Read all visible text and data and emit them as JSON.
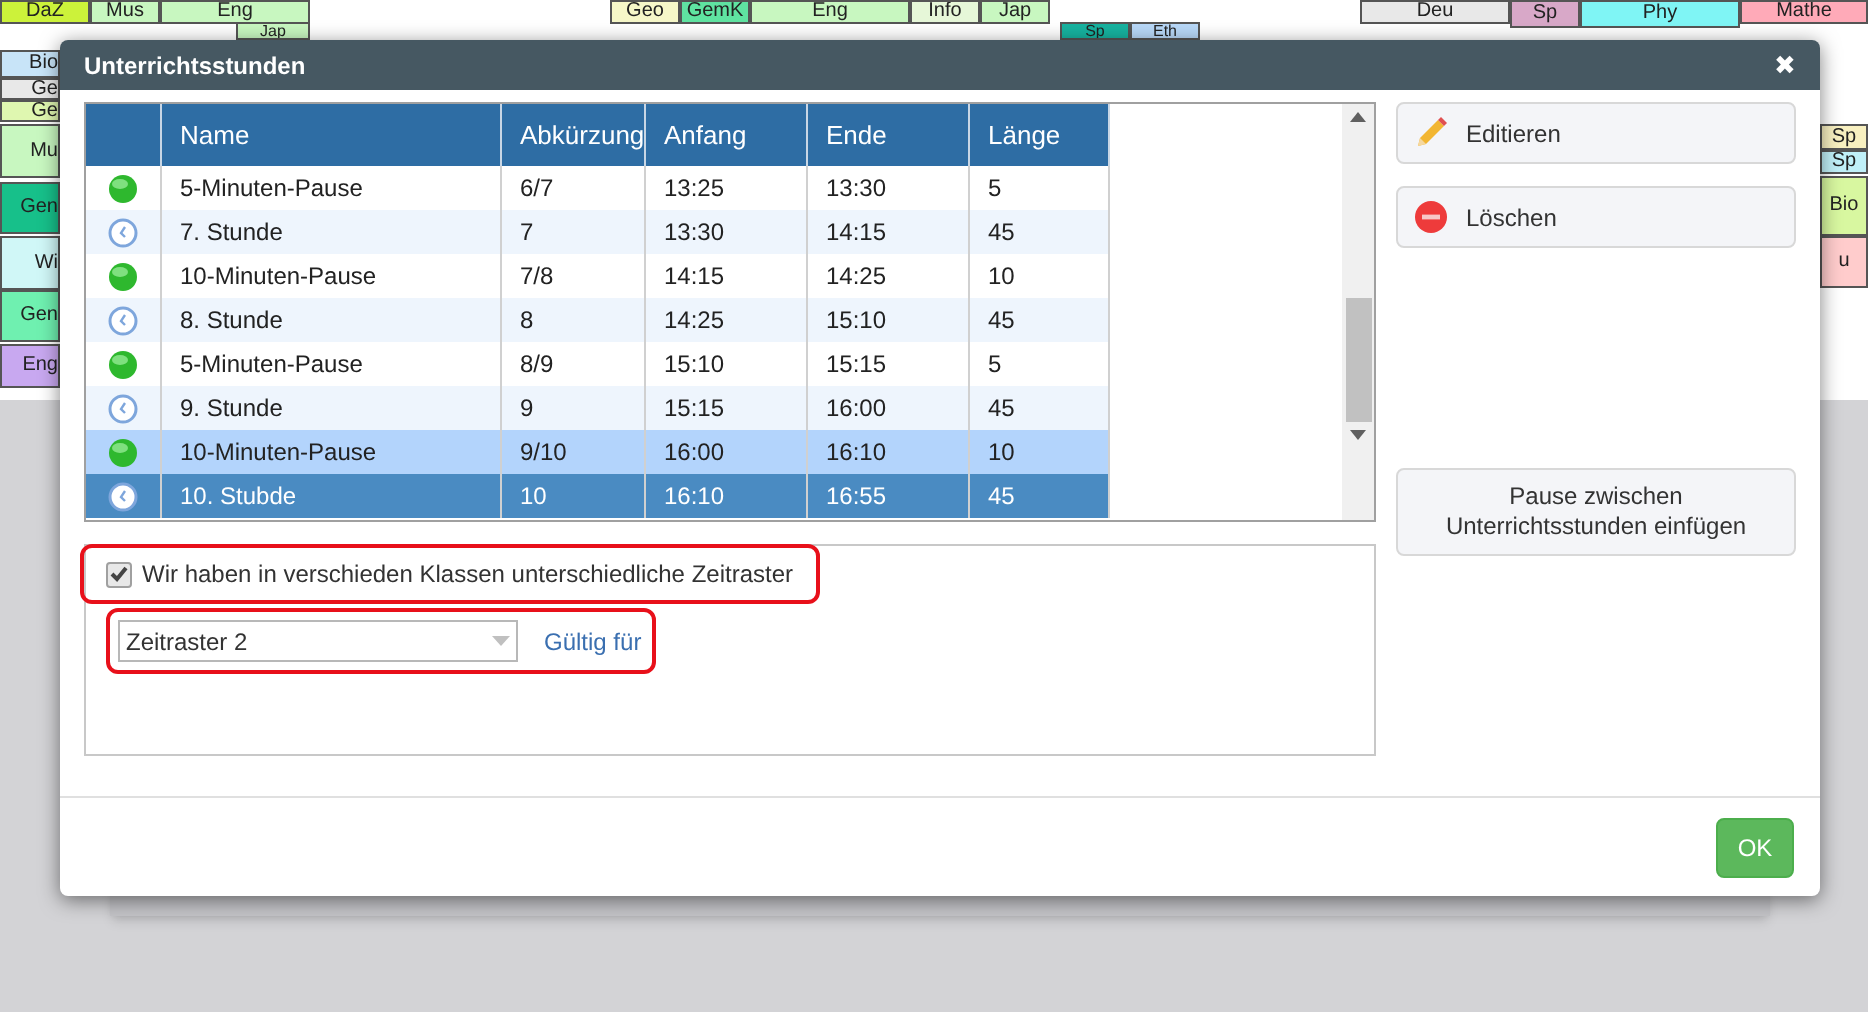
{
  "background_cells": [
    {
      "text": "DaZ",
      "color": "#ccf23a"
    },
    {
      "text": "Mus",
      "color": "#c8f7c0"
    },
    {
      "text": "Eng",
      "color": "#c8f7c0"
    },
    {
      "text": "Geo",
      "color": "#f6f7c8"
    },
    {
      "text": "GemK",
      "color": "#5fe3a1"
    },
    {
      "text": "Eng",
      "color": "#c8f7c0"
    },
    {
      "text": "Info",
      "color": "#e6f7d8"
    },
    {
      "text": "Jap",
      "color": "#c8f7c0"
    },
    {
      "text": "Deu",
      "color": "#e8e8e8"
    },
    {
      "text": "Sp",
      "color": "#d8a8c8"
    },
    {
      "text": "Phy",
      "color": "#7ff5f5"
    },
    {
      "text": "Mathe",
      "color": "#ffaab8"
    },
    {
      "text": "Jap",
      "color": "#c8f7c0"
    },
    {
      "text": "Sp",
      "color": "#17b3a0"
    },
    {
      "text": "Eth",
      "color": "#b8d8f8"
    },
    {
      "text": "Bio",
      "color": "#c8e4f8"
    },
    {
      "text": "Ge",
      "color": "#e8e8e8"
    },
    {
      "text": "Ge",
      "color": "#dff7b0"
    },
    {
      "text": "Mu",
      "color": "#c8f7c0"
    },
    {
      "text": "Gen",
      "color": "#17c08a"
    },
    {
      "text": "Wi",
      "color": "#d0f7f7"
    },
    {
      "text": "Gen",
      "color": "#6ff0b0"
    },
    {
      "text": "Eng",
      "color": "#c8a8f0"
    },
    {
      "text": "Sp",
      "color": "#f8f0c0"
    },
    {
      "text": "Sp",
      "color": "#c0f0f8"
    },
    {
      "text": "Bio",
      "color": "#d8f7a0"
    },
    {
      "text": "u",
      "color": "#ffcccc"
    }
  ],
  "dialog": {
    "title": "Unterrichtsstunden",
    "close": "✖",
    "table": {
      "columns": [
        "Name",
        "Abkürzung",
        "Anfang",
        "Ende",
        "Länge"
      ],
      "rows": [
        {
          "kind": "pause",
          "name": "5-Minuten-Pause",
          "abbr": "6/7",
          "start": "13:25",
          "end": "13:30",
          "length": "5",
          "selected": false,
          "highlighted": false
        },
        {
          "kind": "lesson",
          "name": "7. Stunde",
          "abbr": "7",
          "start": "13:30",
          "end": "14:15",
          "length": "45",
          "selected": false,
          "highlighted": false
        },
        {
          "kind": "pause",
          "name": "10-Minuten-Pause",
          "abbr": "7/8",
          "start": "14:15",
          "end": "14:25",
          "length": "10",
          "selected": false,
          "highlighted": false
        },
        {
          "kind": "lesson",
          "name": "8. Stunde",
          "abbr": "8",
          "start": "14:25",
          "end": "15:10",
          "length": "45",
          "selected": false,
          "highlighted": false
        },
        {
          "kind": "pause",
          "name": "5-Minuten-Pause",
          "abbr": "8/9",
          "start": "15:10",
          "end": "15:15",
          "length": "5",
          "selected": false,
          "highlighted": false
        },
        {
          "kind": "lesson",
          "name": "9. Stunde",
          "abbr": "9",
          "start": "15:15",
          "end": "16:00",
          "length": "45",
          "selected": false,
          "highlighted": false
        },
        {
          "kind": "pause",
          "name": "10-Minuten-Pause",
          "abbr": "9/10",
          "start": "16:00",
          "end": "16:10",
          "length": "10",
          "selected": false,
          "highlighted": true
        },
        {
          "kind": "lesson",
          "name": "10. Stubde",
          "abbr": "10",
          "start": "16:10",
          "end": "16:55",
          "length": "45",
          "selected": true,
          "highlighted": false
        }
      ]
    },
    "checkbox": {
      "label": "Wir haben in verschieden Klassen unterschiedliche Zeitraster",
      "checked": true
    },
    "select": {
      "value": "Zeitraster 2"
    },
    "link": "Gültig für",
    "buttons": {
      "edit": "Editieren",
      "delete": "Löschen",
      "insert_pause": "Pause zwischen Unterrichtsstunden einfügen",
      "ok": "OK"
    }
  }
}
